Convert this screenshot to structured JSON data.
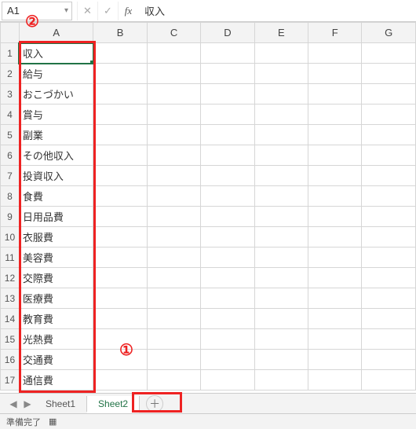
{
  "formula_bar": {
    "name_box": "A1",
    "cancel_glyph": "✕",
    "confirm_glyph": "✓",
    "fx_glyph": "fx",
    "value": "収入"
  },
  "columns": [
    "A",
    "B",
    "C",
    "D",
    "E",
    "F",
    "G"
  ],
  "rows_visible": 17,
  "data_colA": [
    "収入",
    "給与",
    "おこづかい",
    "賞与",
    "副業",
    "その他収入",
    "投資収入",
    "食費",
    "日用品費",
    "衣服費",
    "美容費",
    "交際費",
    "医療費",
    "教育費",
    "光熱費",
    "交通費",
    "通信費"
  ],
  "active_cell": {
    "row": 1,
    "col": "A"
  },
  "tabs": {
    "nav_prev": "◀",
    "nav_next": "▶",
    "items": [
      {
        "label": "Sheet1",
        "active": false
      },
      {
        "label": "Sheet2",
        "active": true
      }
    ],
    "add_glyph": "＋"
  },
  "status": {
    "text": "準備完了",
    "macro_glyph": "▦"
  },
  "annotations": {
    "circle1": "①",
    "circle2": "②"
  },
  "chart_data": {
    "type": "table",
    "title": "Column A values (category list)",
    "categories": [
      "収入",
      "給与",
      "おこづかい",
      "賞与",
      "副業",
      "その他収入",
      "投資収入",
      "食費",
      "日用品費",
      "衣服費",
      "美容費",
      "交際費",
      "医療費",
      "教育費",
      "光熱費",
      "交通費",
      "通信費"
    ]
  }
}
